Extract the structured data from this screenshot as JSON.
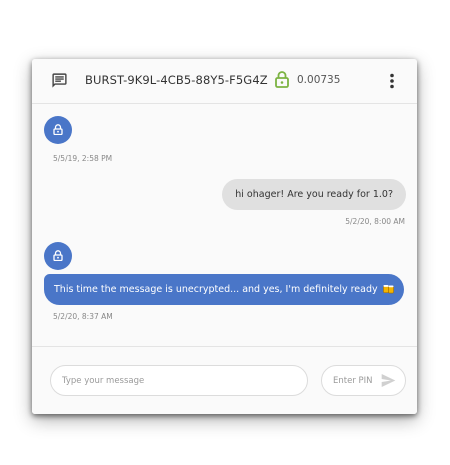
{
  "header": {
    "icon": "chat-icon",
    "address": "BURST-9K9L-4CB5-88Y5-F5G4Z",
    "lock_icon": "lock-open-icon",
    "balance": "0.00735",
    "menu_icon": "more-vert-icon"
  },
  "messages": [
    {
      "direction": "incoming",
      "encrypted": true,
      "text": "",
      "timestamp": "5/5/19, 2:58 PM"
    },
    {
      "direction": "outgoing",
      "text": "hi ohager! Are you ready for 1.0?",
      "timestamp": "5/2/20, 8:00 AM"
    },
    {
      "direction": "incoming",
      "encrypted": false,
      "text": "This time the message is unecrypted... and yes, I'm definitely ready",
      "emoji": "beer-mugs-emoji",
      "timestamp": "5/2/20, 8:37 AM"
    }
  ],
  "composer": {
    "message_placeholder": "Type your message",
    "message_value": "",
    "pin_placeholder": "Enter PIN",
    "pin_value": "",
    "send_icon": "send-icon"
  },
  "colors": {
    "accent": "#4a76c8",
    "incoming_bubble": "#e0e0e0",
    "lock_green": "#7cb342"
  }
}
